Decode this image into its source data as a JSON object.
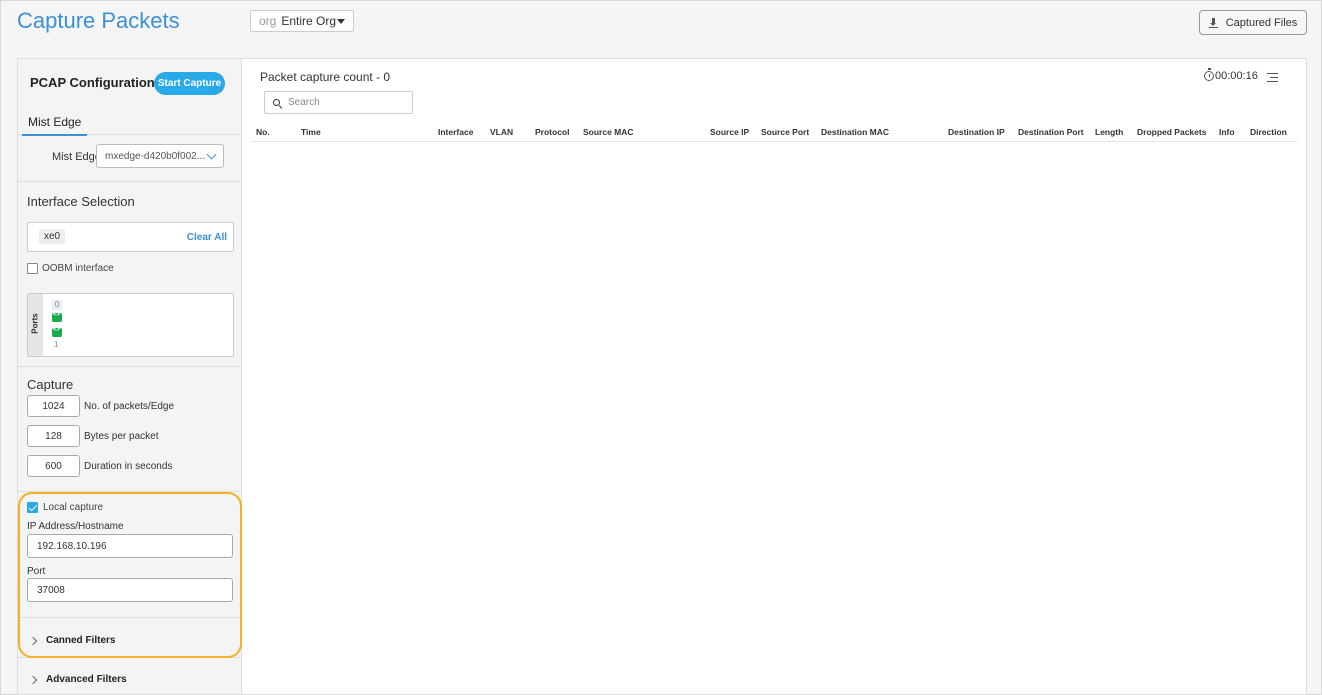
{
  "header": {
    "title": "Capture Packets",
    "org_prefix": "org",
    "org_value": "Entire Org",
    "captured_files_label": "Captured Files"
  },
  "left": {
    "pcap_title": "PCAP Configuration",
    "start_label": "Start Capture",
    "tab_label": "Mist Edge",
    "mist_edge_label": "Mist Edge",
    "mist_edge_value": "mxedge-d420b0f002...",
    "interface_title": "Interface Selection",
    "selected_chip": "xe0",
    "clear_all": "Clear All",
    "oobm_label": "OOBM interface",
    "ports_label": "Ports",
    "port_top": "0",
    "port_bottom": "1",
    "capture_title": "Capture",
    "capture_fields": [
      {
        "value": "1024",
        "label": "No. of packets/Edge"
      },
      {
        "value": "128",
        "label": "Bytes per packet"
      },
      {
        "value": "600",
        "label": "Duration in seconds"
      }
    ],
    "local_capture_label": "Local capture",
    "local_capture_checked": true,
    "ip_label": "IP Address/Hostname",
    "ip_value": "192.168.10.196",
    "port_label": "Port",
    "port_value": "37008",
    "canned_filters": "Canned Filters",
    "advanced_filters": "Advanced Filters"
  },
  "main": {
    "count_title": "Packet capture count - 0",
    "timer": "00:00:16",
    "search_placeholder": "Search",
    "columns": [
      "No.",
      "Time",
      "Interface",
      "VLAN",
      "Protocol",
      "Source MAC",
      "Source IP",
      "Source Port",
      "Destination MAC",
      "Destination IP",
      "Destination Port",
      "Length",
      "Dropped Packets",
      "Info",
      "Direction"
    ]
  },
  "colors": {
    "accent": "#3d8fd6",
    "start_button": "#2aa9e8",
    "highlight": "#f6b026",
    "port_up": "#19a84a"
  }
}
